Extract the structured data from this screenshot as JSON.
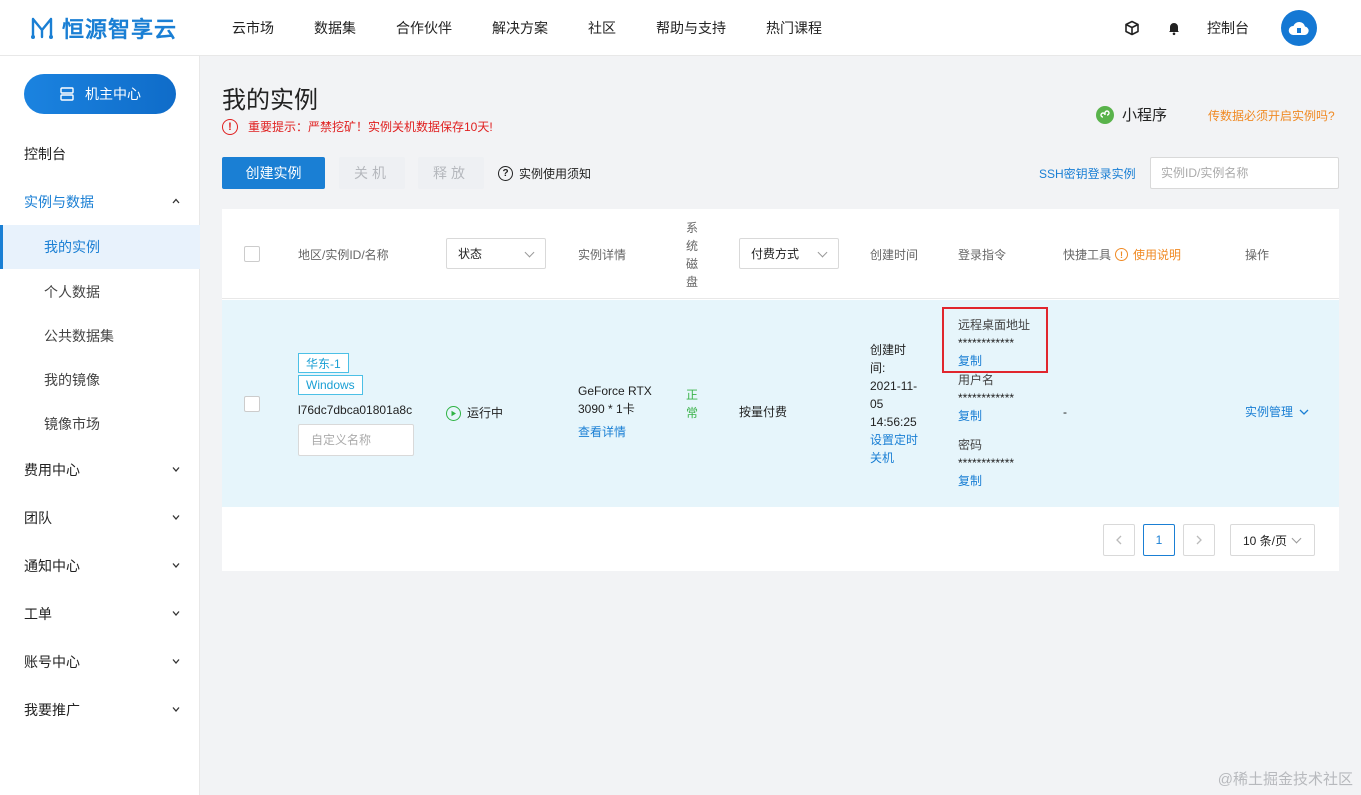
{
  "brand": {
    "name": "恒源智享云"
  },
  "nav": {
    "items": [
      "云市场",
      "数据集",
      "合作伙伴",
      "解决方案",
      "社区",
      "帮助与支持",
      "热门课程"
    ]
  },
  "top_right": {
    "console": "控制台"
  },
  "sidebar": {
    "host_center": "机主中心",
    "items": [
      {
        "label": "控制台"
      },
      {
        "label": "实例与数据"
      },
      {
        "label": "我的实例"
      },
      {
        "label": "个人数据"
      },
      {
        "label": "公共数据集"
      },
      {
        "label": "我的镜像"
      },
      {
        "label": "镜像市场"
      },
      {
        "label": "费用中心"
      },
      {
        "label": "团队"
      },
      {
        "label": "通知中心"
      },
      {
        "label": "工单"
      },
      {
        "label": "账号中心"
      },
      {
        "label": "我要推广"
      }
    ]
  },
  "page": {
    "title": "我的实例",
    "warning": "重要提示：严禁挖矿！实例关机数据保存10天!",
    "mini_program": "小程序",
    "mini_link": "传数据必须开启实例吗?",
    "create_btn": "创建实例",
    "shutdown_btn": "关机",
    "release_btn": "释放",
    "notice": "实例使用须知",
    "ssh_link": "SSH密钥登录实例",
    "search_placeholder": "实例ID/实例名称"
  },
  "table": {
    "headers": {
      "region": "地区/实例ID/名称",
      "status": "状态",
      "detail": "实例详情",
      "disk_vertical": [
        "系",
        "统",
        "磁",
        "盘"
      ],
      "billing": "付费方式",
      "created": "创建时间",
      "login": "登录指令",
      "tools": "快捷工具",
      "tools_help": "使用说明",
      "actions": "操作"
    },
    "row": {
      "region_tag": "华东-1",
      "os_tag": "Windows",
      "instance_id": "l76dc7dbca01801a8c",
      "name_placeholder": "自定义名称",
      "status": "运行中",
      "gpu_line1": "GeForce RTX",
      "gpu_line2": "3090 * 1卡",
      "view_detail": "查看详情",
      "disk_status": [
        "正",
        "常"
      ],
      "billing": "按量付费",
      "created_label_1": "创建时",
      "created_label_2": "间:",
      "created_date_1": "2021-11-",
      "created_date_2": "05",
      "created_time": "14:56:25",
      "schedule_1": "设置定时",
      "schedule_2": "关机",
      "rdp_label": "远程桌面地址",
      "rdp_value": "************",
      "copy": "复制",
      "user_label": "用户名",
      "user_value": "************",
      "pwd_label": "密码",
      "pwd_value": "************",
      "tools_value": "-",
      "manage": "实例管理"
    }
  },
  "pagination": {
    "current": "1",
    "page_size": "10 条/页"
  },
  "watermark": "@稀土掘金技术社区",
  "colors": {
    "brand": "#1a7fd4",
    "warning": "#e02020",
    "orange": "#f08a24",
    "row_bg": "#e6f5fb",
    "highlight_box": "#e0262d"
  }
}
